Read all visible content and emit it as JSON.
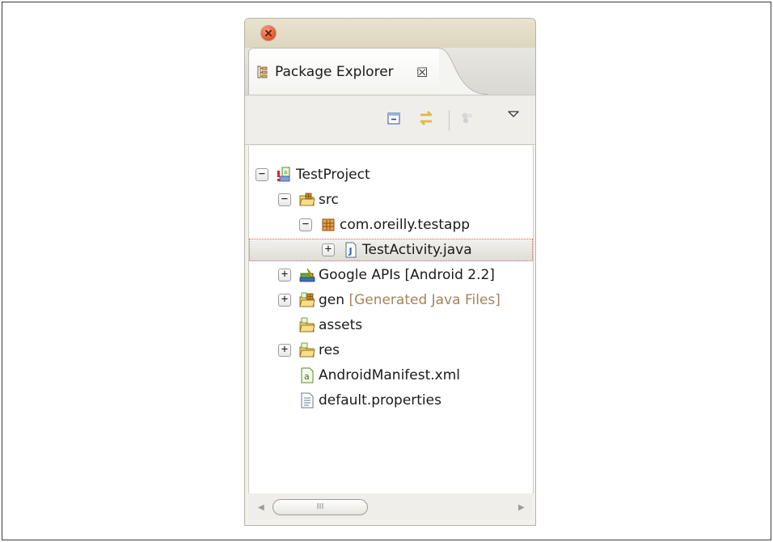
{
  "window": {
    "tab_title": "Package Explorer",
    "tab_close_glyph": "☒"
  },
  "toolbar": {
    "buttons": [
      "collapse-all-icon",
      "link-with-editor-icon",
      "filter-icon",
      "view-menu-icon"
    ]
  },
  "tree": {
    "nodes": [
      {
        "label": "TestProject",
        "icon": "android-project-icon",
        "expanded": true
      },
      {
        "label": "src",
        "icon": "source-folder-icon",
        "expanded": true
      },
      {
        "label": "com.oreilly.testapp",
        "icon": "package-icon",
        "expanded": true
      },
      {
        "label": "TestActivity.java",
        "icon": "java-file-icon",
        "expanded": false,
        "selected": true
      },
      {
        "label": "Google APIs [Android 2.2]",
        "icon": "library-icon",
        "expanded": false
      },
      {
        "label": "gen",
        "decoration": "[Generated Java Files]",
        "icon": "gen-folder-icon",
        "expanded": false
      },
      {
        "label": "assets",
        "icon": "folder-icon"
      },
      {
        "label": "res",
        "icon": "folder-icon",
        "expanded": false
      },
      {
        "label": "AndroidManifest.xml",
        "icon": "manifest-icon"
      },
      {
        "label": "default.properties",
        "icon": "text-file-icon"
      }
    ]
  },
  "scrollbar": {
    "thumb_grip": "III"
  },
  "colors": {
    "decoration_text": "#a2845e",
    "selection_outline": "#d66666"
  }
}
